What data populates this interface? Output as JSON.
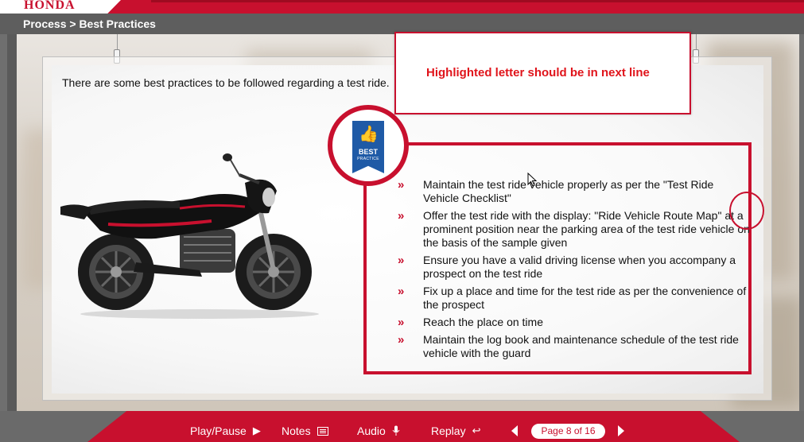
{
  "header": {
    "logo": "HONDA",
    "breadcrumb": "Process > Best Practices"
  },
  "intro": "There are some best practices to be followed regarding a test ride.",
  "badge": {
    "title": "BEST",
    "subtitle": "PRACTICE",
    "icon": "thumbs-up-icon"
  },
  "practices": [
    "Maintain the test ride vehicle properly as per the \"Test Ride Vehicle Checklist\"",
    "Offer the test ride with the display: \"Ride Vehicle Route Map\" at a prominent position near the parking area of the test ride vehicle on the basis of the sample given",
    "Ensure you have a valid driving license when you accompany a prospect on the test ride",
    "Fix up a place and time for the test ride as per the convenience of the prospect",
    "Reach the place on time",
    "Maintain the log book and maintenance schedule of the test ride vehicle with the guard"
  ],
  "bullet_glyph": "»",
  "annotation": {
    "text": "Highlighted letter should be in next line"
  },
  "controls": {
    "play_pause": "Play/Pause",
    "notes": "Notes",
    "audio": "Audio",
    "replay": "Replay",
    "page_indicator": "Page 8 of 16",
    "current_page": 8,
    "total_pages": 16
  },
  "colors": {
    "brand_red": "#c8102e",
    "badge_blue": "#1f5aa6",
    "annotation_red": "#e0141b"
  }
}
